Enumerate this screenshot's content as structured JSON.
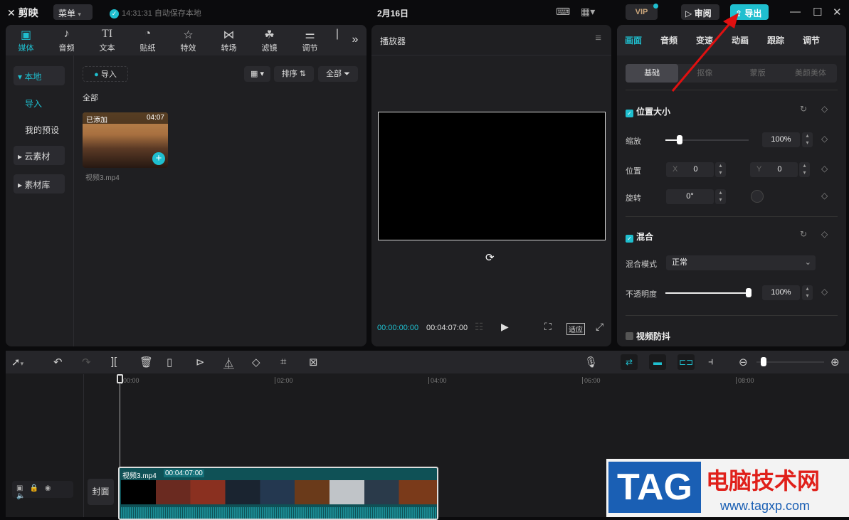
{
  "app": {
    "name": "剪映",
    "menu_label": "菜单",
    "save_status": "14:31:31 自动保存本地",
    "date": "2月16日",
    "vip": "VIP",
    "review": "审阅",
    "export": "导出"
  },
  "media_tabs": [
    {
      "label": "媒体",
      "icon": "media-icon"
    },
    {
      "label": "音频",
      "icon": "audio-icon"
    },
    {
      "label": "文本",
      "icon": "text-icon",
      "glyph": "TI"
    },
    {
      "label": "贴纸",
      "icon": "sticker-icon"
    },
    {
      "label": "特效",
      "icon": "effects-icon"
    },
    {
      "label": "转场",
      "icon": "transition-icon"
    },
    {
      "label": "滤镜",
      "icon": "filter-icon"
    },
    {
      "label": "调节",
      "icon": "adjust-icon"
    }
  ],
  "sidebar": {
    "local": "本地",
    "import": "导入",
    "presets": "我的预设",
    "cloud": "云素材",
    "library": "素材库"
  },
  "media": {
    "import_label": "导入",
    "sort_label": "排序",
    "filter_label": "全部",
    "section": "全部",
    "items": [
      {
        "name": "视频3.mp4",
        "badge": "已添加",
        "duration": "04:07"
      }
    ]
  },
  "player": {
    "title": "播放器",
    "current_time": "00:00:00:00",
    "total_time": "00:04:07:00",
    "fit_label": "适应"
  },
  "props": {
    "tabs": [
      "画面",
      "音频",
      "变速",
      "动画",
      "跟踪",
      "调节"
    ],
    "subtabs": [
      "基础",
      "抠像",
      "蒙版",
      "美颜美体"
    ],
    "position_size": {
      "title": "位置大小",
      "scale_label": "缩放",
      "scale_value": "100%",
      "scale_fraction": 0.17,
      "position_label": "位置",
      "x_label": "X",
      "x_value": "0",
      "y_label": "Y",
      "y_value": "0",
      "rotate_label": "旋转",
      "rotate_value": "0°"
    },
    "blend": {
      "title": "混合",
      "mode_label": "混合模式",
      "mode_value": "正常",
      "opacity_label": "不透明度",
      "opacity_value": "100%",
      "opacity_fraction": 1.0
    },
    "stabilize": {
      "title": "视频防抖"
    }
  },
  "timeline": {
    "ruler": [
      "00:00",
      "02:00",
      "04:00",
      "06:00",
      "08:00"
    ],
    "cover_label": "封面",
    "clip": {
      "name": "视频3.mp4",
      "duration": "00:04:07:00"
    }
  },
  "watermark": {
    "logo": "TAG",
    "site_name": "电脑技术网",
    "url": "www.tagxp.com"
  },
  "colors": {
    "accent": "#1fbfcf",
    "annotation_arrow": "#e01010"
  }
}
